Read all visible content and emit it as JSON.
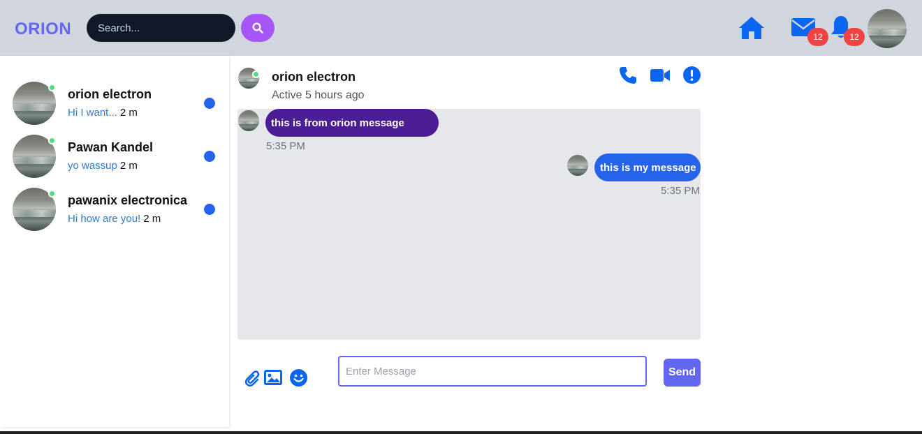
{
  "header": {
    "brand": "ORION",
    "search_placeholder": "Search...",
    "mail_badge": "12",
    "notification_badge": "12"
  },
  "conversations": [
    {
      "name": "orion electron",
      "preview": "Hi I want...",
      "time": "2 m",
      "online": true,
      "unread": true
    },
    {
      "name": "Pawan Kandel",
      "preview": "yo wassup",
      "time": "2 m",
      "online": true,
      "unread": true
    },
    {
      "name": "pawanix electronica",
      "preview": "Hi how are you!",
      "time": "2 m",
      "online": true,
      "unread": true
    }
  ],
  "chat": {
    "contact_name": "orion electron",
    "status": "Active 5 hours ago",
    "messages": [
      {
        "direction": "incoming",
        "text": "this is from orion message",
        "time": "5:35 PM"
      },
      {
        "direction": "outgoing",
        "text": "this is my message",
        "time": "5:35 PM"
      }
    ]
  },
  "composer": {
    "placeholder": "Enter Message",
    "send_label": "Send"
  },
  "colors": {
    "brand": "#6366f1",
    "accent_blue": "#2563eb",
    "incoming_bubble": "#4c1d95",
    "badge": "#ef4444",
    "online": "#4ade80"
  }
}
